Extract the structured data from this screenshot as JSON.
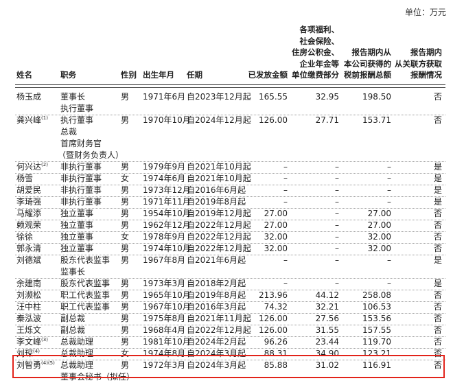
{
  "unit_label": "单位：万元",
  "headers": {
    "name": "姓名",
    "position": "职务",
    "gender": "性别",
    "birth": "出生年月",
    "term": "任期",
    "paid": "已发放金额",
    "welfare": [
      "各项福利、",
      "社会保险、",
      "住房公积金、",
      "企业年金等",
      "单位缴费部分"
    ],
    "total": [
      "报告期内从",
      "本公司获得的",
      "税前报酬总额"
    ],
    "related": [
      "报告期内",
      "从关联方获取",
      "报酬情况"
    ]
  },
  "rows": [
    {
      "name": "杨玉成",
      "sup": "",
      "position": [
        "董事长",
        "执行董事"
      ],
      "gender": "男",
      "birth": "1971年6月",
      "term": "自2023年12月起",
      "paid": "165.55",
      "welfare": "32.95",
      "total": "198.50",
      "related": "否"
    },
    {
      "name": "龚兴峰",
      "sup": "(1)",
      "position": [
        "执行董事",
        "总裁",
        "首席财务官",
        "（暨财务负责人）"
      ],
      "gender": "男",
      "birth": "1970年10月",
      "term": "自2024年12月起",
      "paid": "126.00",
      "welfare": "27.71",
      "total": "153.71",
      "related": "否"
    },
    {
      "name": "何兴达",
      "sup": "(2)",
      "position": [
        "非执行董事"
      ],
      "gender": "男",
      "birth": "1979年9月",
      "term": "自2021年10月起",
      "paid": "–",
      "welfare": "–",
      "total": "–",
      "related": "是"
    },
    {
      "name": "杨雪",
      "sup": "",
      "position": [
        "非执行董事"
      ],
      "gender": "女",
      "birth": "1974年6月",
      "term": "自2021年10月起",
      "paid": "–",
      "welfare": "–",
      "total": "–",
      "related": "是"
    },
    {
      "name": "胡爱民",
      "sup": "",
      "position": [
        "非执行董事"
      ],
      "gender": "男",
      "birth": "1973年12月",
      "term": "自2016年6月起",
      "paid": "–",
      "welfare": "–",
      "total": "–",
      "related": "是"
    },
    {
      "name": "李琦强",
      "sup": "",
      "position": [
        "非执行董事"
      ],
      "gender": "男",
      "birth": "1971年11月",
      "term": "自2019年8月起",
      "paid": "–",
      "welfare": "–",
      "total": "–",
      "related": "是"
    },
    {
      "name": "马耀添",
      "sup": "",
      "position": [
        "独立董事"
      ],
      "gender": "男",
      "birth": "1954年10月",
      "term": "自2019年12月起",
      "paid": "27.00",
      "welfare": "–",
      "total": "27.00",
      "related": "否"
    },
    {
      "name": "赖观荣",
      "sup": "",
      "position": [
        "独立董事"
      ],
      "gender": "男",
      "birth": "1962年12月",
      "term": "自2022年12月起",
      "paid": "27.00",
      "welfare": "–",
      "total": "27.00",
      "related": "否"
    },
    {
      "name": "徐徐",
      "sup": "",
      "position": [
        "独立董事"
      ],
      "gender": "女",
      "birth": "1978年9月",
      "term": "自2022年12月起",
      "paid": "32.00",
      "welfare": "–",
      "total": "32.00",
      "related": "否"
    },
    {
      "name": "郭永清",
      "sup": "",
      "position": [
        "独立董事"
      ],
      "gender": "男",
      "birth": "1974年10月",
      "term": "自2022年12月起",
      "paid": "32.00",
      "welfare": "–",
      "total": "32.00",
      "related": "否"
    },
    {
      "name": "刘德斌",
      "sup": "",
      "position": [
        "股东代表监事",
        "监事长"
      ],
      "gender": "男",
      "birth": "1967年8月",
      "term": "自2021年6月起",
      "paid": "–",
      "welfare": "–",
      "total": "–",
      "related": "是"
    },
    {
      "name": "余建南",
      "sup": "",
      "position": [
        "股东代表监事"
      ],
      "gender": "男",
      "birth": "1973年3月",
      "term": "自2018年2月起",
      "paid": "–",
      "welfare": "–",
      "total": "–",
      "related": "是"
    },
    {
      "name": "刘濒松",
      "sup": "",
      "position": [
        "职工代表监事"
      ],
      "gender": "男",
      "birth": "1965年10月",
      "term": "自2019年8月起",
      "paid": "213.96",
      "welfare": "44.12",
      "total": "258.08",
      "related": "否"
    },
    {
      "name": "汪中柱",
      "sup": "",
      "position": [
        "职工代表监事"
      ],
      "gender": "男",
      "birth": "1967年10月",
      "term": "自2016年3月起",
      "paid": "74.32",
      "welfare": "32.21",
      "total": "106.53",
      "related": "否"
    },
    {
      "name": "秦泓波",
      "sup": "",
      "position": [
        "副总裁"
      ],
      "gender": "男",
      "birth": "1975年8月",
      "term": "自2021年11月起",
      "paid": "126.00",
      "welfare": "27.56",
      "total": "153.56",
      "related": "否"
    },
    {
      "name": "王烁文",
      "sup": "",
      "position": [
        "副总裁"
      ],
      "gender": "男",
      "birth": "1968年4月",
      "term": "自2022年12月起",
      "paid": "126.00",
      "welfare": "31.55",
      "total": "157.55",
      "related": "否"
    },
    {
      "name": "李文峰",
      "sup": "(3)",
      "position": [
        "总裁助理"
      ],
      "gender": "男",
      "birth": "1981年10月",
      "term": "自2024年2月起",
      "paid": "96.26",
      "welfare": "23.44",
      "total": "119.70",
      "related": "否"
    },
    {
      "name": "刘琛",
      "sup": "(4)",
      "position": [
        "总裁助理"
      ],
      "gender": "女",
      "birth": "1974年8月",
      "term": "自2024年3月起",
      "paid": "88.31",
      "welfare": "34.90",
      "total": "123.21",
      "related": "否"
    },
    {
      "name": "刘智勇",
      "sup": "(4)(5)",
      "position": [
        "总裁助理",
        "董事会秘书（拟任）"
      ],
      "gender": "男",
      "birth": "1972年3月",
      "term": "自2024年3月起",
      "paid": "85.88",
      "welfare": "31.02",
      "total": "116.91",
      "related": "否"
    }
  ]
}
